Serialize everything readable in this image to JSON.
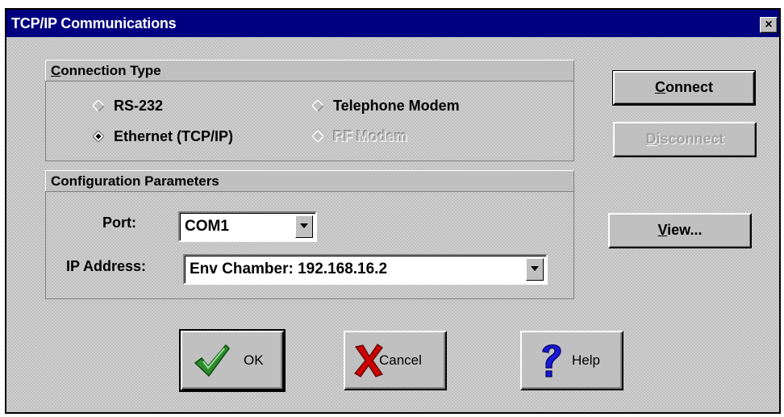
{
  "window": {
    "title": "TCP/IP Communications",
    "close_glyph": "×"
  },
  "connection_type": {
    "header": "Connection Type",
    "header_accel": "C",
    "header_rest": "onnection Type",
    "options": [
      {
        "label": "RS-232",
        "selected": false,
        "enabled": true
      },
      {
        "label": "Telephone Modem",
        "selected": false,
        "enabled": true
      },
      {
        "label": "Ethernet (TCP/IP)",
        "selected": true,
        "enabled": true
      },
      {
        "label": "RF Modem",
        "selected": false,
        "enabled": false
      }
    ]
  },
  "config": {
    "header": "Configuration Parameters",
    "port_label": "Port:",
    "port_value": "COM1",
    "ip_label": "IP Address:",
    "ip_value": "Env Chamber: 192.168.16.2"
  },
  "buttons": {
    "connect_accel": "C",
    "connect_rest": "onnect",
    "disconnect_accel": "D",
    "disconnect_rest": "isconnect",
    "view_accel": "V",
    "view_rest": "iew...",
    "ok": "OK",
    "cancel": "Cancel",
    "help": "Help"
  },
  "icons": {
    "ok": "checkmark-icon",
    "cancel": "x-icon",
    "help": "question-icon"
  },
  "colors": {
    "titlebar": "#000080",
    "face": "#c0c0c0",
    "ok_green": "#2e8b2e",
    "cancel_red": "#cc0000",
    "help_blue": "#0000cc"
  }
}
